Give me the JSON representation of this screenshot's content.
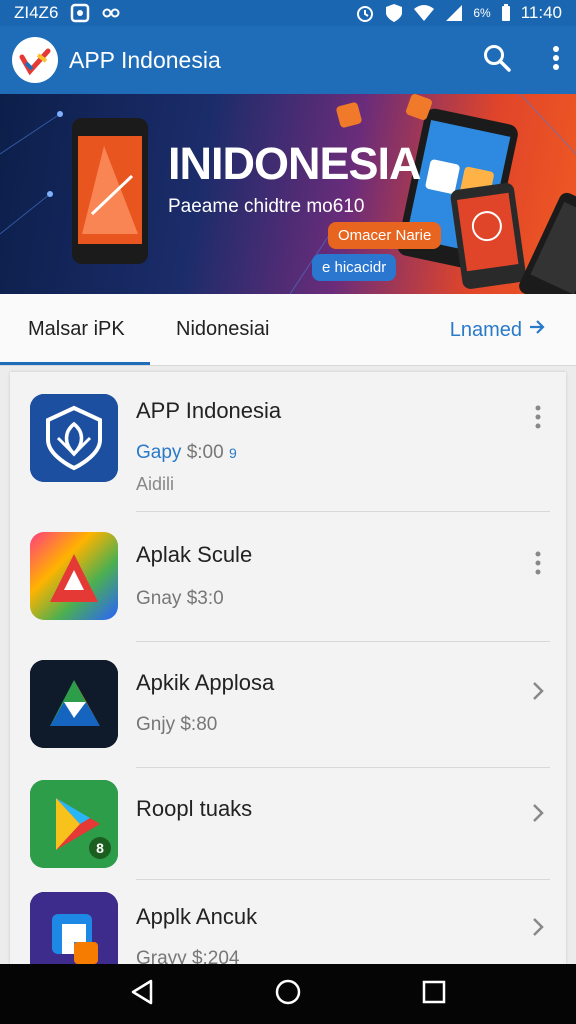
{
  "status_bar": {
    "time": "11:40",
    "left_text": "ZI4Z6",
    "battery": "6%",
    "icons": [
      "alarm-icon",
      "vpn-icon",
      "wifi-icon",
      "signal-icon",
      "battery-icon"
    ]
  },
  "app_bar": {
    "title": "APP Indonesia",
    "actions": [
      "search-icon",
      "more-vert-icon"
    ]
  },
  "banner": {
    "title": "INIDONESIA",
    "subtitle": "Paeame chidtre mo610",
    "pill_primary": "Omacer Narie",
    "pill_secondary": "e hicacidr"
  },
  "tabs": {
    "items": [
      {
        "label": "Malsar iPK",
        "active": true
      },
      {
        "label": "Nidonesiai",
        "active": false
      }
    ],
    "link_label": "Lnamed"
  },
  "apps": [
    {
      "name": "APP Indonesia",
      "price_accent": "Gapy",
      "price": "$:00",
      "price_badge": "9",
      "extra": "Aidili",
      "action": "more-vert-icon"
    },
    {
      "name": "Aplak Scule",
      "price_accent": "",
      "price": "Gnay $3:0",
      "price_badge": "",
      "extra": "",
      "action": "more-vert-icon"
    },
    {
      "name": "Apkik Applosa",
      "price_accent": "",
      "price": "Gnjy $:80",
      "price_badge": "",
      "extra": "",
      "action": "chevron-right-icon"
    },
    {
      "name": "Roopl tuaks",
      "price_accent": "",
      "price": "",
      "price_badge": "",
      "extra": "",
      "action": "chevron-right-icon"
    },
    {
      "name": "Applk Ancuk",
      "price_accent": "",
      "price": "Grayy $:204",
      "price_badge": "",
      "extra": "",
      "action": "chevron-right-icon"
    }
  ],
  "nav_bar": {
    "buttons": [
      "back-icon",
      "home-icon",
      "recents-icon"
    ]
  },
  "colors": {
    "primary": "#1f6db8",
    "accent_link": "#2a7ac8",
    "banner_orange": "#f05a22",
    "nav_bg": "#050505"
  }
}
